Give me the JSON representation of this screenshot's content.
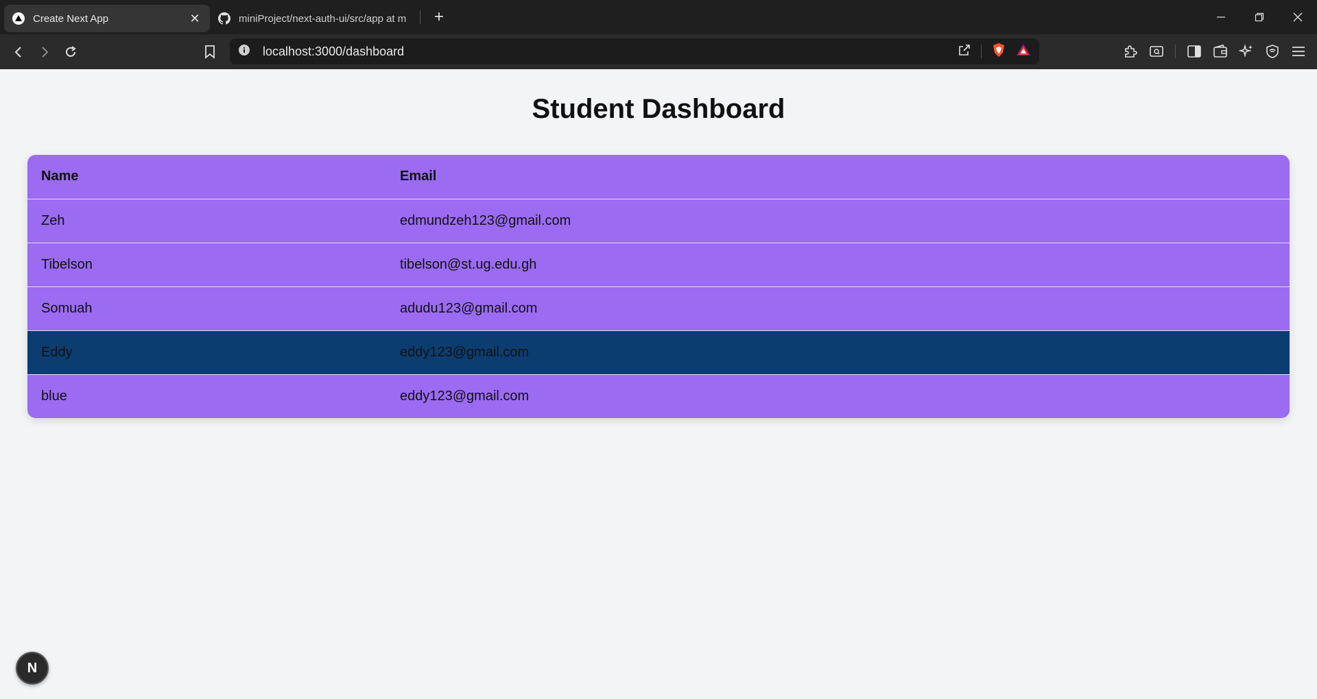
{
  "browser": {
    "tabs": [
      {
        "title": "Create Next App",
        "active": true,
        "icon": "nextjs-triangle-icon"
      },
      {
        "title": "miniProject/next-auth-ui/src/app at m",
        "active": false,
        "icon": "github-icon"
      }
    ],
    "address": "localhost:3000/dashboard"
  },
  "page": {
    "title": "Student Dashboard",
    "table": {
      "headers": {
        "name": "Name",
        "email": "Email"
      },
      "rows": [
        {
          "name": "Zeh",
          "email": "edmundzeh123@gmail.com"
        },
        {
          "name": "Tibelson",
          "email": "tibelson@st.ug.edu.gh"
        },
        {
          "name": "Somuah",
          "email": "adudu123@gmail.com"
        },
        {
          "name": "Eddy",
          "email": "eddy123@gmail.com",
          "highlighted": true
        },
        {
          "name": "blue",
          "email": "eddy123@gmail.com"
        }
      ]
    },
    "dev_badge": "N"
  },
  "colors": {
    "table_bg": "#9b6bf2",
    "highlight_row": "#0c3d70",
    "page_bg": "#f3f4f6"
  }
}
